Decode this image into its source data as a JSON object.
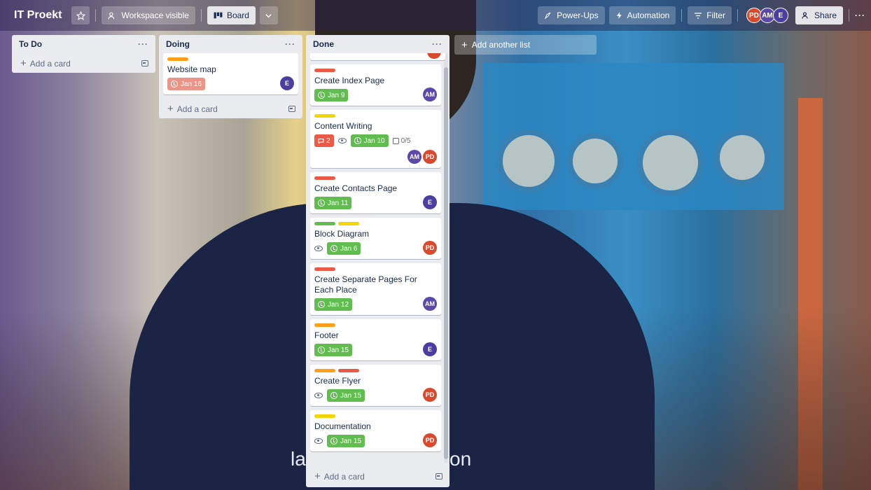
{
  "header": {
    "board_title": "IT Proekt",
    "star_icon": "star-icon",
    "visibility_label": "Workspace visible",
    "view_label": "Board",
    "powerups_label": "Power-Ups",
    "automation_label": "Automation",
    "filter_label": "Filter",
    "share_label": "Share",
    "members": [
      "PD",
      "AM",
      "E"
    ],
    "more_label": "···"
  },
  "lists": {
    "todo": {
      "title": "To Do",
      "menu": "···",
      "add_card": "Add a card"
    },
    "doing": {
      "title": "Doing",
      "menu": "···",
      "add_card": "Add a card",
      "cards": [
        {
          "title": "Website map",
          "date": "Jan 16",
          "member": "E",
          "label_color": "#ff9f1a"
        }
      ]
    },
    "done": {
      "title": "Done",
      "menu": "···",
      "add_card": "Add a card",
      "cards": [
        {
          "title": "Create Index Page",
          "date": "Jan 9",
          "members": [
            "AM"
          ]
        },
        {
          "title": "Content Writing",
          "comments": "2",
          "date": "Jan 10",
          "checklist": "0/5",
          "members": [
            "AM",
            "PD"
          ]
        },
        {
          "title": "Create Contacts Page",
          "date": "Jan 11",
          "members": [
            "E"
          ]
        },
        {
          "title": "Block Diagram",
          "date": "Jan 6",
          "members": [
            "PD"
          ]
        },
        {
          "title": "Create Separate Pages For Each Place",
          "date": "Jan 12",
          "members": [
            "AM"
          ]
        },
        {
          "title": "Footer",
          "date": "Jan 15",
          "members": [
            "E"
          ]
        },
        {
          "title": "Create Flyer",
          "date": "Jan 15",
          "members": [
            "PD"
          ]
        },
        {
          "title": "Documentation",
          "date": "Jan 15",
          "members": [
            "PD"
          ]
        }
      ]
    }
  },
  "add_list_label": "Add another list",
  "colors": {
    "label_red": "#eb5a46",
    "label_yellow": "#f2d600",
    "label_green": "#61bd4f",
    "label_orange": "#ff9f1a",
    "date_green": "#61bd4f"
  },
  "background_text": {
    "left": "la",
    "right": "on"
  }
}
